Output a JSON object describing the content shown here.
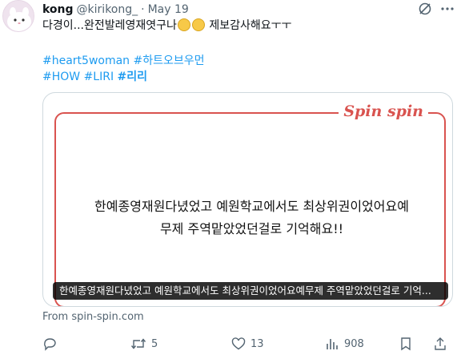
{
  "user": {
    "display_name": "kong",
    "handle": "@kirikong_",
    "separator": "·",
    "date": "May 19"
  },
  "tweet": {
    "text_before": "다경이...완전발레영재엿구나",
    "text_after": " 제보감사해요ㅜㅜ",
    "hashtags_line1": [
      "#heart5woman",
      "#하트오브우먼"
    ],
    "hashtags_line2": [
      "#HOW",
      "#LIRI",
      "#리리"
    ]
  },
  "card": {
    "logo_text": "Spin spin",
    "message_line1": "한예종영재원다녔었고 예원학교에서도 최상위권이었어요예",
    "message_line2": "무제 주역맡았었던걸로 기억해요!!",
    "caption": "한예종영재원다녔었고 예원학교에서도 최상위권이었어요예무제 주역맡았었던걸로 기억..."
  },
  "source": "From spin-spin.com",
  "actions": {
    "reply_count": "",
    "retweet_count": "5",
    "like_count": "13",
    "views_count": "908"
  },
  "colors": {
    "accent": "#1d9bf0",
    "brand_red": "#d9534f",
    "muted": "#536471"
  },
  "icons": [
    "grok-icon",
    "more-icon",
    "reply-icon",
    "retweet-icon",
    "like-icon",
    "views-icon",
    "bookmark-icon",
    "share-icon"
  ]
}
